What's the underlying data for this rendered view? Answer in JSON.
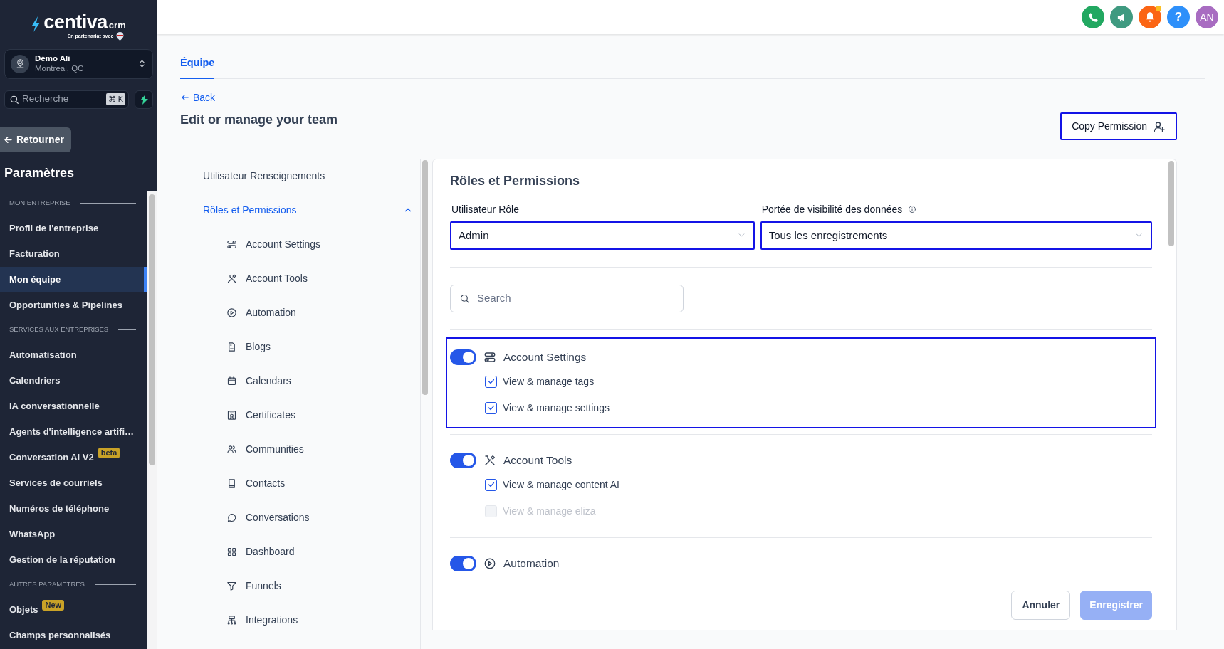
{
  "sidebar": {
    "logo": {
      "name": "centiva",
      "suffix": "crm",
      "tagline": "En partenariat avec"
    },
    "account": {
      "name": "Démo Ali",
      "location": "Montreal, QC"
    },
    "search": {
      "placeholder": "Recherche",
      "shortcut": "⌘ K"
    },
    "back_button": "Retourner",
    "title": "Paramètres",
    "nav": [
      {
        "kind": "section",
        "label": "MON ENTREPRISE"
      },
      {
        "kind": "item",
        "label": "Profil de l'entreprise",
        "selected": false
      },
      {
        "kind": "item",
        "label": "Facturation",
        "selected": false
      },
      {
        "kind": "item",
        "label": "Mon équipe",
        "selected": true
      },
      {
        "kind": "item",
        "label": "Opportunities & Pipelines",
        "selected": false
      },
      {
        "kind": "section",
        "label": "SERVICES AUX ENTREPRISES"
      },
      {
        "kind": "item",
        "label": "Automatisation",
        "selected": false
      },
      {
        "kind": "item",
        "label": "Calendriers",
        "selected": false
      },
      {
        "kind": "item",
        "label": "IA conversationnelle",
        "selected": false
      },
      {
        "kind": "item",
        "label": "Agents d'intelligence artifi…",
        "selected": false
      },
      {
        "kind": "item",
        "label": "Conversation AI V2",
        "selected": false,
        "badge": "beta"
      },
      {
        "kind": "item",
        "label": "Services de courriels",
        "selected": false
      },
      {
        "kind": "item",
        "label": "Numéros de téléphone",
        "selected": false
      },
      {
        "kind": "item",
        "label": "WhatsApp",
        "selected": false
      },
      {
        "kind": "item",
        "label": "Gestion de la réputation",
        "selected": false
      },
      {
        "kind": "section",
        "label": "AUTRES PARAMÈTRES"
      },
      {
        "kind": "item",
        "label": "Objets",
        "selected": false,
        "badge": "New"
      },
      {
        "kind": "item",
        "label": "Champs personnalisés",
        "selected": false
      }
    ]
  },
  "header": {
    "help": "?",
    "avatar": "AN",
    "notification_dot": true
  },
  "page": {
    "tabs": [
      {
        "label": "Équipe",
        "selected": true
      }
    ],
    "back_link": "Back",
    "title": "Edit or manage your team",
    "copy_button": "Copy Permission"
  },
  "menu": [
    {
      "label": "Utilisateur Renseignements",
      "selected": false
    },
    {
      "label": "Rôles et Permissions",
      "selected": true,
      "expanded": true,
      "children": [
        {
          "label": "Account Settings"
        },
        {
          "label": "Account Tools"
        },
        {
          "label": "Automation"
        },
        {
          "label": "Blogs"
        },
        {
          "label": "Calendars"
        },
        {
          "label": "Certificates"
        },
        {
          "label": "Communities"
        },
        {
          "label": "Contacts"
        },
        {
          "label": "Conversations"
        },
        {
          "label": "Dashboard"
        },
        {
          "label": "Funnels"
        },
        {
          "label": "Integrations"
        }
      ]
    }
  ],
  "panel": {
    "title": "Rôles et Permissions",
    "fields": [
      {
        "label": "Utilisateur Rôle",
        "value": "Admin",
        "focused": true,
        "info": false
      },
      {
        "label": "Portée de visibilité des données",
        "value": "Tous les enregistrements",
        "focused": true,
        "info": true
      }
    ],
    "search": {
      "placeholder": "Search"
    },
    "groups": [
      {
        "title": "Account Settings",
        "on": true,
        "highlighted": true,
        "permissions": [
          {
            "label": "View & manage tags",
            "checked": true,
            "disabled": false
          },
          {
            "label": "View & manage settings",
            "checked": true,
            "disabled": false
          }
        ]
      },
      {
        "title": "Account Tools",
        "on": true,
        "highlighted": false,
        "permissions": [
          {
            "label": "View & manage content AI",
            "checked": true,
            "disabled": false
          },
          {
            "label": "View & manage eliza",
            "checked": false,
            "disabled": true
          }
        ]
      },
      {
        "title": "Automation",
        "on": true,
        "highlighted": false
      }
    ],
    "footer": {
      "cancel": "Annuler",
      "save": {
        "label": "Enregistrer",
        "disabled": true
      }
    }
  }
}
